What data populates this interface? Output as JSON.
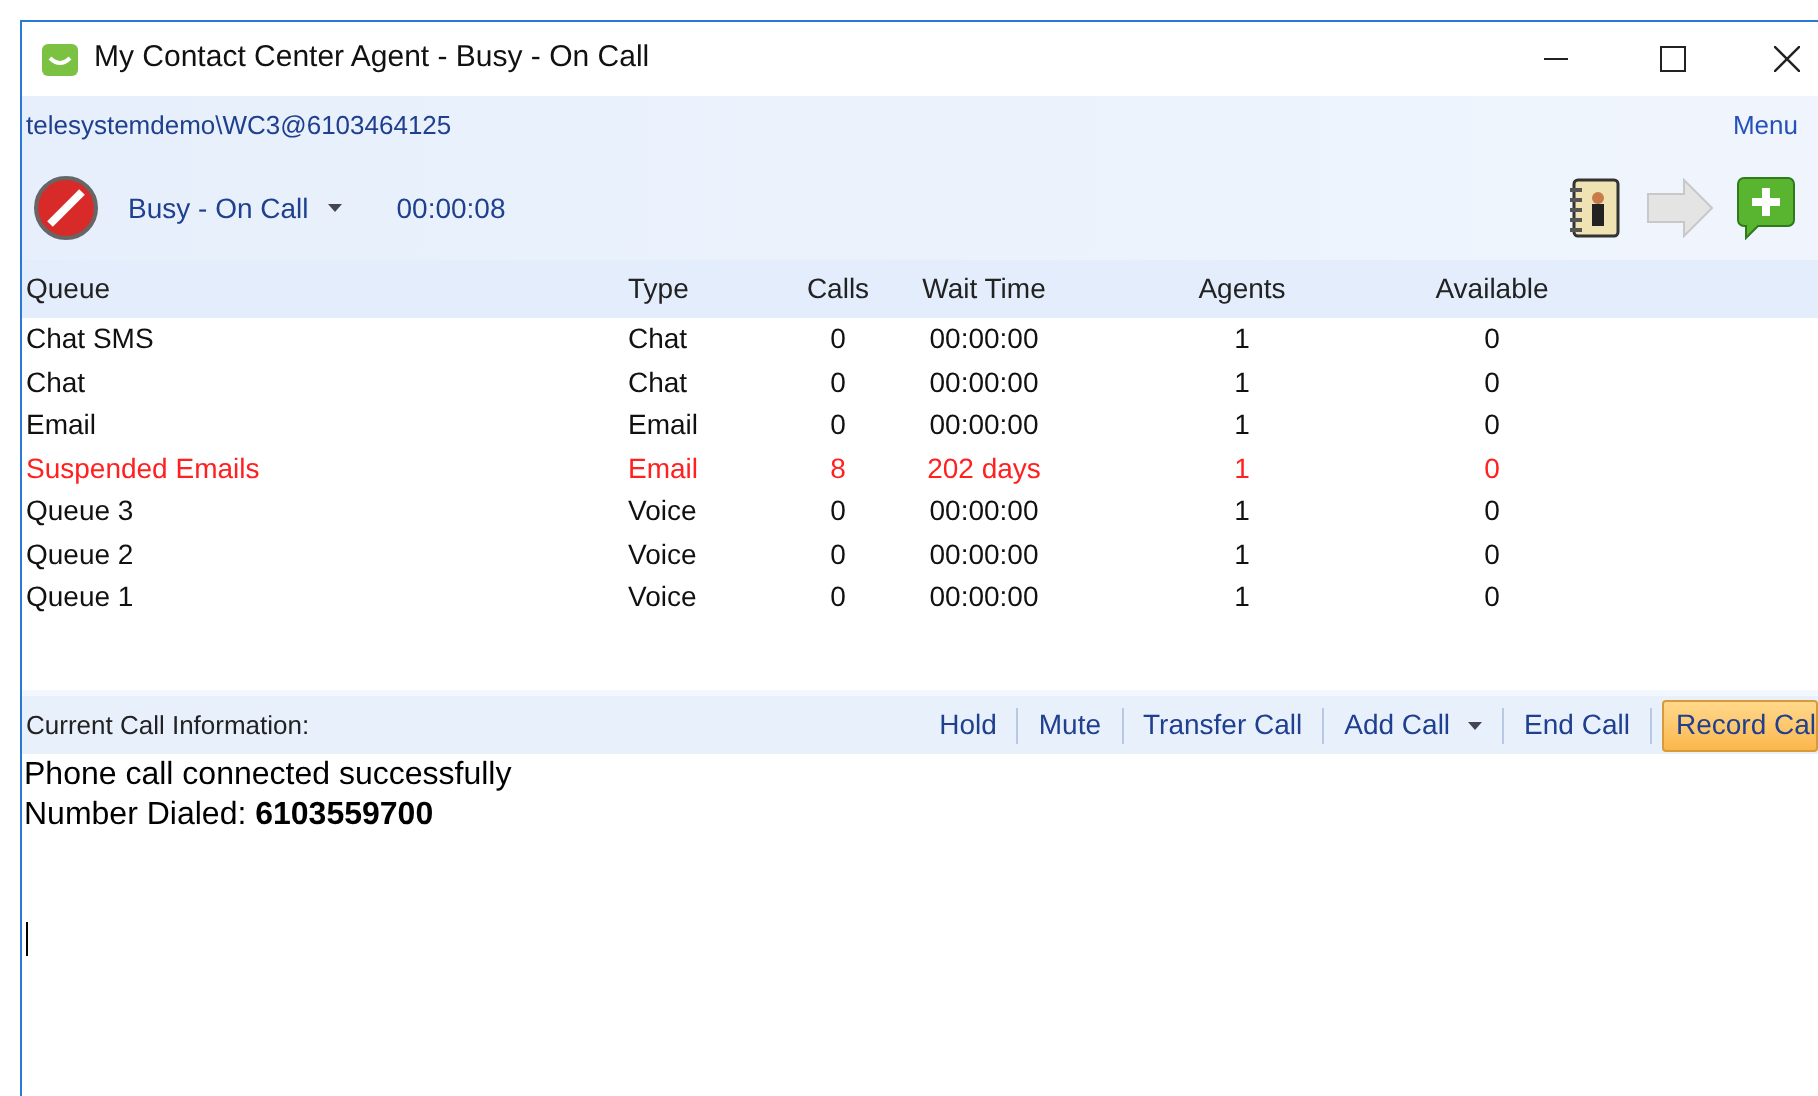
{
  "window": {
    "title": "My Contact Center Agent - Busy - On Call"
  },
  "account": "telesystemdemo\\WC3@6103464125",
  "menu": "Menu",
  "status": {
    "label": "Busy - On Call",
    "timer": "00:00:08"
  },
  "table": {
    "columns": [
      "Queue",
      "Type",
      "Calls",
      "Wait Time",
      "Agents",
      "Available"
    ],
    "rows": [
      {
        "cells": [
          "Chat SMS",
          "Chat",
          "0",
          "00:00:00",
          "1",
          "0"
        ],
        "flagged": false
      },
      {
        "cells": [
          "Chat",
          "Chat",
          "0",
          "00:00:00",
          "1",
          "0"
        ],
        "flagged": false
      },
      {
        "cells": [
          "Email",
          "Email",
          "0",
          "00:00:00",
          "1",
          "0"
        ],
        "flagged": false
      },
      {
        "cells": [
          "Suspended Emails",
          "Email",
          "8",
          "202 days",
          "1",
          "0"
        ],
        "flagged": true
      },
      {
        "cells": [
          "Queue 3",
          "Voice",
          "0",
          "00:00:00",
          "1",
          "0"
        ],
        "flagged": false
      },
      {
        "cells": [
          "Queue 2",
          "Voice",
          "0",
          "00:00:00",
          "1",
          "0"
        ],
        "flagged": false
      },
      {
        "cells": [
          "Queue 1",
          "Voice",
          "0",
          "00:00:00",
          "1",
          "0"
        ],
        "flagged": false
      }
    ]
  },
  "call_bar": {
    "label": "Current Call Information:",
    "buttons": [
      {
        "label": "Hold",
        "has_menu": false,
        "active": false
      },
      {
        "label": "Mute",
        "has_menu": false,
        "active": false
      },
      {
        "label": "Transfer Call",
        "has_menu": false,
        "active": false
      },
      {
        "label": "Add Call",
        "has_menu": true,
        "active": false
      },
      {
        "label": "End Call",
        "has_menu": false,
        "active": false
      },
      {
        "label": "Record Cal",
        "has_menu": false,
        "active": true
      }
    ]
  },
  "message": [
    "Phone call connected successfully",
    "Number Dialed: **6103559700**"
  ]
}
